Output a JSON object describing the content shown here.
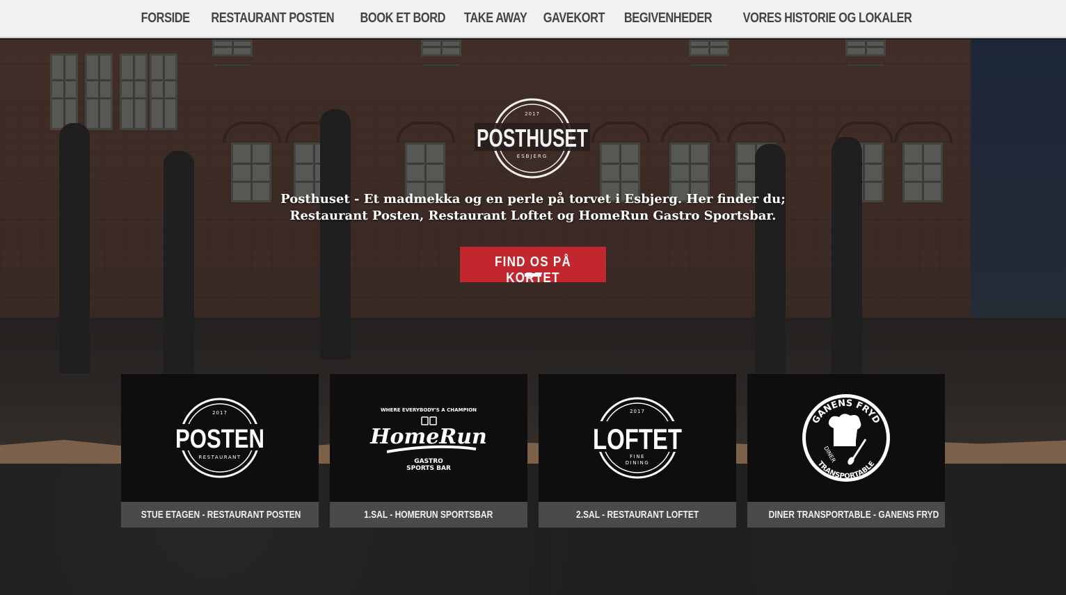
{
  "nav": {
    "items": [
      {
        "label": "FORSIDE"
      },
      {
        "label": "RESTAURANT POSTEN"
      },
      {
        "label": "BOOK ET BORD"
      },
      {
        "label": "TAKE AWAY"
      },
      {
        "label": "GAVEKORT"
      },
      {
        "label": "BEGIVENHEDER"
      },
      {
        "label": "VORES HISTORIE OG LOKALER"
      }
    ]
  },
  "hero": {
    "logo": {
      "name": "POSTHUSET",
      "year": "2017",
      "city": "ESBJERG"
    },
    "tagline_line1": "Posthuset - Et madmekka og en perle på torvet i Esbjerg. Her finder du;",
    "tagline_line2": "Restaurant Posten, Restaurant Loftet og HomeRun Gastro Sportsbar.",
    "cta_label": "FIND OS PÅ KORTET"
  },
  "cards": [
    {
      "label": "STUE ETAGEN - RESTAURANT POSTEN",
      "logo": {
        "year": "2017",
        "name": "POSTEN",
        "sub": "RESTAURANT"
      }
    },
    {
      "label": "1.SAL - HOMERUN SPORTSBAR",
      "logo": {
        "top": "WHERE EVERYBODY'S A CHAMPION",
        "name": "HomeRun",
        "sub1": "GASTRO",
        "sub2": "SPORTS BAR"
      }
    },
    {
      "label": "2.SAL - RESTAURANT LOFTET",
      "logo": {
        "year": "2017",
        "name": "LOFTET",
        "sub1": "FINE",
        "sub2": "DINING"
      }
    },
    {
      "label": "DINER TRANSPORTABLE - GANENS FRYD",
      "logo": {
        "top": "GANENS FRYD",
        "left": "DINER",
        "bottom": "TRANSPORTABLE"
      }
    }
  ],
  "colors": {
    "accent": "#c2262e",
    "nav_bg": "#f1f1f1",
    "card_label_bg": "#4a4a4a"
  }
}
